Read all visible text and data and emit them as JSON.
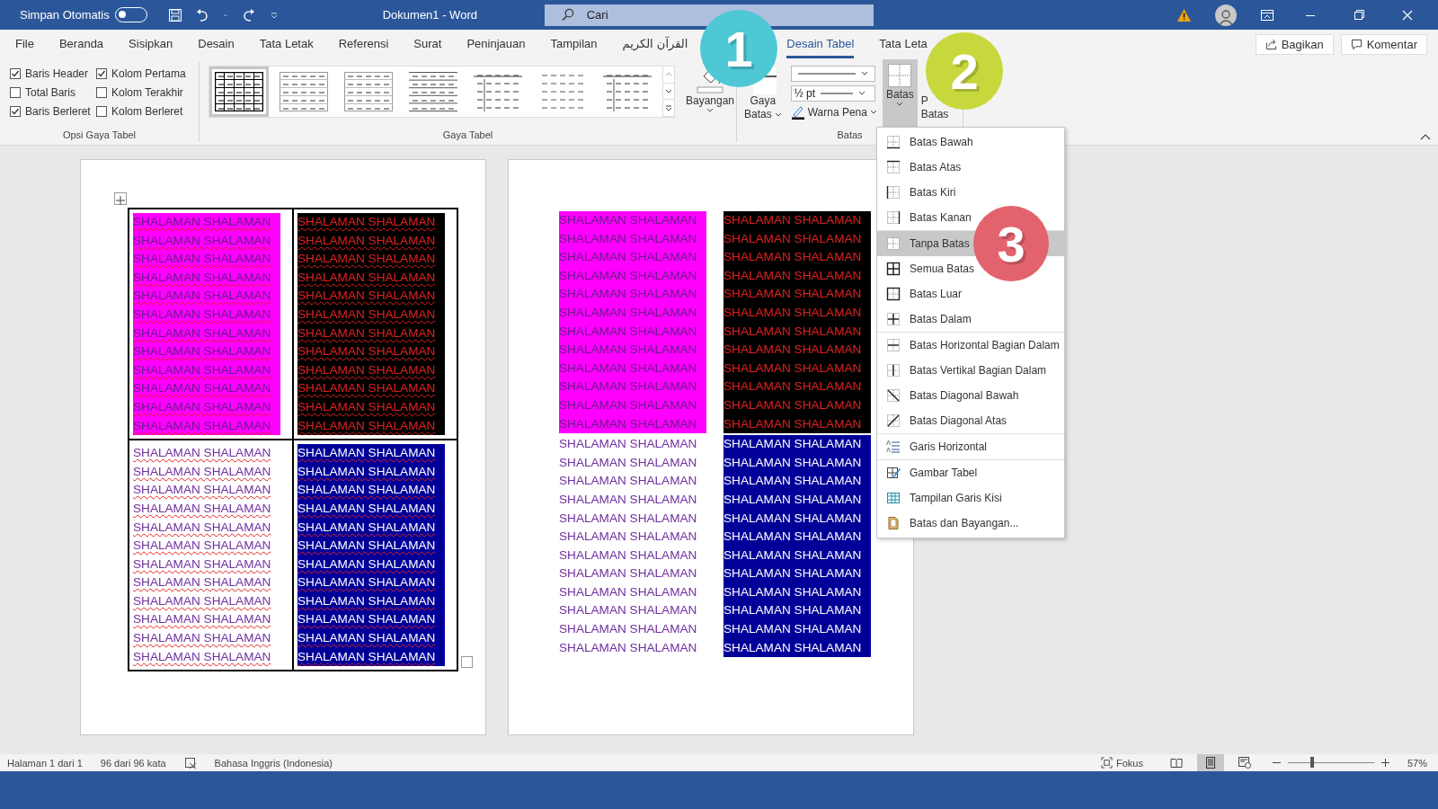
{
  "window": {
    "title": "Dokumen1 - Word"
  },
  "title_bar": {
    "autosave": {
      "label": "Simpan Otomatis",
      "on": false
    },
    "search": {
      "placeholder": "Cari"
    }
  },
  "tabs": [
    {
      "label": "File",
      "selected": false
    },
    {
      "label": "Beranda",
      "selected": false
    },
    {
      "label": "Sisipkan",
      "selected": false
    },
    {
      "label": "Desain",
      "selected": false
    },
    {
      "label": "Tata Letak",
      "selected": false
    },
    {
      "label": "Referensi",
      "selected": false
    },
    {
      "label": "Surat",
      "selected": false
    },
    {
      "label": "Peninjauan",
      "selected": false
    },
    {
      "label": "Tampilan",
      "selected": false
    },
    {
      "label": "القرآن الكريم",
      "selected": false
    },
    {
      "label": "Desain Tabel",
      "selected": true
    },
    {
      "label": "Tata Leta",
      "selected": false
    }
  ],
  "share_buttons": [
    {
      "kind": "share",
      "label": "Bagikan"
    },
    {
      "kind": "comment",
      "label": "Komentar"
    }
  ],
  "table_style_options": {
    "title": "Opsi Gaya Tabel",
    "options": [
      {
        "label": "Baris Header",
        "checked": true
      },
      {
        "label": "Kolom Pertama",
        "checked": true
      },
      {
        "label": "Total Baris",
        "checked": false
      },
      {
        "label": "Kolom Terakhir",
        "checked": false
      },
      {
        "label": "Baris Berleret",
        "checked": true
      },
      {
        "label": "Kolom Berleret",
        "checked": false
      }
    ]
  },
  "table_styles": {
    "title": "Gaya Tabel",
    "styles": [
      {
        "kind": "grid",
        "selected": true
      },
      {
        "kind": "light",
        "selected": false
      },
      {
        "kind": "light",
        "selected": false
      },
      {
        "kind": "lines",
        "selected": false
      },
      {
        "kind": "column",
        "selected": false
      },
      {
        "kind": "plain",
        "selected": false
      },
      {
        "kind": "column",
        "selected": false
      }
    ],
    "shading": {
      "label": "Bayangan"
    }
  },
  "borders_group": {
    "title": "Batas",
    "border_styles": {
      "label_lines": [
        "Gaya",
        "Batas"
      ]
    },
    "weight": "½ pt",
    "pen_color": {
      "label": "Warna Pena"
    },
    "borders_button": {
      "label": "Batas",
      "expanded": true
    },
    "border_painter": {
      "label_lines": [
        "P",
        "Batas"
      ]
    }
  },
  "border_menu": {
    "groups": [
      [
        {
          "kind": "bottom",
          "label": "Batas Bawah",
          "selected": false
        },
        {
          "kind": "top",
          "label": "Batas Atas",
          "selected": false
        },
        {
          "kind": "left",
          "label": "Batas Kiri",
          "selected": false
        },
        {
          "kind": "right",
          "label": "Batas Kanan",
          "selected": false
        }
      ],
      [
        {
          "kind": "none",
          "label": "Tanpa Batas",
          "selected": true
        },
        {
          "kind": "all",
          "label": "Semua Batas",
          "selected": false
        },
        {
          "kind": "outside",
          "label": "Batas Luar",
          "selected": false
        },
        {
          "kind": "inside",
          "label": "Batas Dalam",
          "selected": false
        }
      ],
      [
        {
          "kind": "inside-h",
          "label": "Batas Horizontal Bagian Dalam",
          "selected": false
        },
        {
          "kind": "inside-v",
          "label": "Batas Vertikal Bagian Dalam",
          "selected": false
        },
        {
          "kind": "diag-down",
          "label": "Batas Diagonal Bawah",
          "selected": false
        },
        {
          "kind": "diag-up",
          "label": "Batas Diagonal Atas",
          "selected": false
        }
      ],
      [
        {
          "kind": "hline",
          "label": "Garis Horizontal",
          "selected": false
        }
      ],
      [
        {
          "kind": "draw",
          "label": "Gambar Tabel",
          "selected": false
        },
        {
          "kind": "grid",
          "label": "Tampilan Garis Kisi",
          "selected": false
        },
        {
          "kind": "dialog",
          "label": "Batas dan Bayangan...",
          "selected": false
        }
      ]
    ]
  },
  "pages": [
    {
      "borders": true,
      "spelling_marks": true,
      "handles": true,
      "cells": [
        {
          "kind": "pink",
          "color": "#ff00ff",
          "lines": [
            "SHALAMAN SHALAMAN",
            "SHALAMAN SHALAMAN",
            "SHALAMAN SHALAMAN",
            "SHALAMAN SHALAMAN",
            "SHALAMAN SHALAMAN",
            "SHALAMAN SHALAMAN",
            "SHALAMAN SHALAMAN",
            "SHALAMAN SHALAMAN",
            "SHALAMAN SHALAMAN",
            "SHALAMAN SHALAMAN",
            "SHALAMAN SHALAMAN",
            "SHALAMAN SHALAMAN"
          ]
        },
        {
          "kind": "dark",
          "color": "#000000",
          "lines": [
            "SHALAMAN SHALAMAN",
            "SHALAMAN SHALAMAN",
            "SHALAMAN SHALAMAN",
            "SHALAMAN SHALAMAN",
            "SHALAMAN SHALAMAN",
            "SHALAMAN SHALAMAN",
            "SHALAMAN SHALAMAN",
            "SHALAMAN SHALAMAN",
            "SHALAMAN SHALAMAN",
            "SHALAMAN SHALAMAN",
            "SHALAMAN SHALAMAN",
            "SHALAMAN SHALAMAN"
          ]
        },
        {
          "kind": "plain",
          "color": "#ffffff",
          "lines": [
            "SHALAMAN SHALAMAN",
            "SHALAMAN SHALAMAN",
            "SHALAMAN SHALAMAN",
            "SHALAMAN SHALAMAN",
            "SHALAMAN SHALAMAN",
            "SHALAMAN SHALAMAN",
            "SHALAMAN SHALAMAN",
            "SHALAMAN SHALAMAN",
            "SHALAMAN SHALAMAN",
            "SHALAMAN SHALAMAN",
            "SHALAMAN SHALAMAN",
            "SHALAMAN SHALAMAN"
          ]
        },
        {
          "kind": "navy",
          "color": "#000099",
          "lines": [
            "SHALAMAN SHALAMAN",
            "SHALAMAN SHALAMAN",
            "SHALAMAN SHALAMAN",
            "SHALAMAN SHALAMAN",
            "SHALAMAN SHALAMAN",
            "SHALAMAN SHALAMAN",
            "SHALAMAN SHALAMAN",
            "SHALAMAN SHALAMAN",
            "SHALAMAN SHALAMAN",
            "SHALAMAN SHALAMAN",
            "SHALAMAN SHALAMAN",
            "SHALAMAN SHALAMAN"
          ]
        }
      ]
    },
    {
      "borders": false,
      "spelling_marks": false,
      "handles": false,
      "cells": [
        {
          "kind": "pink",
          "color": "#ff00ff",
          "lines": [
            "SHALAMAN SHALAMAN",
            "SHALAMAN SHALAMAN",
            "SHALAMAN SHALAMAN",
            "SHALAMAN SHALAMAN",
            "SHALAMAN SHALAMAN",
            "SHALAMAN SHALAMAN",
            "SHALAMAN SHALAMAN",
            "SHALAMAN SHALAMAN",
            "SHALAMAN SHALAMAN",
            "SHALAMAN SHALAMAN",
            "SHALAMAN SHALAMAN",
            "SHALAMAN SHALAMAN"
          ]
        },
        {
          "kind": "dark",
          "color": "#000000",
          "lines": [
            "SHALAMAN SHALAMAN",
            "SHALAMAN SHALAMAN",
            "SHALAMAN SHALAMAN",
            "SHALAMAN SHALAMAN",
            "SHALAMAN SHALAMAN",
            "SHALAMAN SHALAMAN",
            "SHALAMAN SHALAMAN",
            "SHALAMAN SHALAMAN",
            "SHALAMAN SHALAMAN",
            "SHALAMAN SHALAMAN",
            "SHALAMAN SHALAMAN",
            "SHALAMAN SHALAMAN"
          ]
        },
        {
          "kind": "plain",
          "color": "#ffffff",
          "lines": [
            "SHALAMAN SHALAMAN",
            "SHALAMAN SHALAMAN",
            "SHALAMAN SHALAMAN",
            "SHALAMAN SHALAMAN",
            "SHALAMAN SHALAMAN",
            "SHALAMAN SHALAMAN",
            "SHALAMAN SHALAMAN",
            "SHALAMAN SHALAMAN",
            "SHALAMAN SHALAMAN",
            "SHALAMAN SHALAMAN",
            "SHALAMAN SHALAMAN",
            "SHALAMAN SHALAMAN"
          ]
        },
        {
          "kind": "navy",
          "color": "#000099",
          "lines": [
            "SHALAMAN SHALAMAN",
            "SHALAMAN SHALAMAN",
            "SHALAMAN SHALAMAN",
            "SHALAMAN SHALAMAN",
            "SHALAMAN SHALAMAN",
            "SHALAMAN SHALAMAN",
            "SHALAMAN SHALAMAN",
            "SHALAMAN SHALAMAN",
            "SHALAMAN SHALAMAN",
            "SHALAMAN SHALAMAN",
            "SHALAMAN SHALAMAN",
            "SHALAMAN SHALAMAN"
          ]
        }
      ]
    }
  ],
  "status_bar": {
    "page": "Halaman 1 dari 1",
    "words": "96 dari 96 kata",
    "language": "Bahasa Inggris (Indonesia)",
    "focus": "Fokus",
    "views": [
      {
        "kind": "read",
        "selected": false
      },
      {
        "kind": "print",
        "selected": true
      },
      {
        "kind": "web",
        "selected": false
      }
    ],
    "zoom": {
      "level": 0.28,
      "reading": "57%"
    }
  },
  "step_badges": [
    {
      "label": "1",
      "color": "#4ec8d4"
    },
    {
      "label": "2",
      "color": "#c6d83c"
    },
    {
      "label": "3",
      "color": "#e2636d"
    }
  ]
}
